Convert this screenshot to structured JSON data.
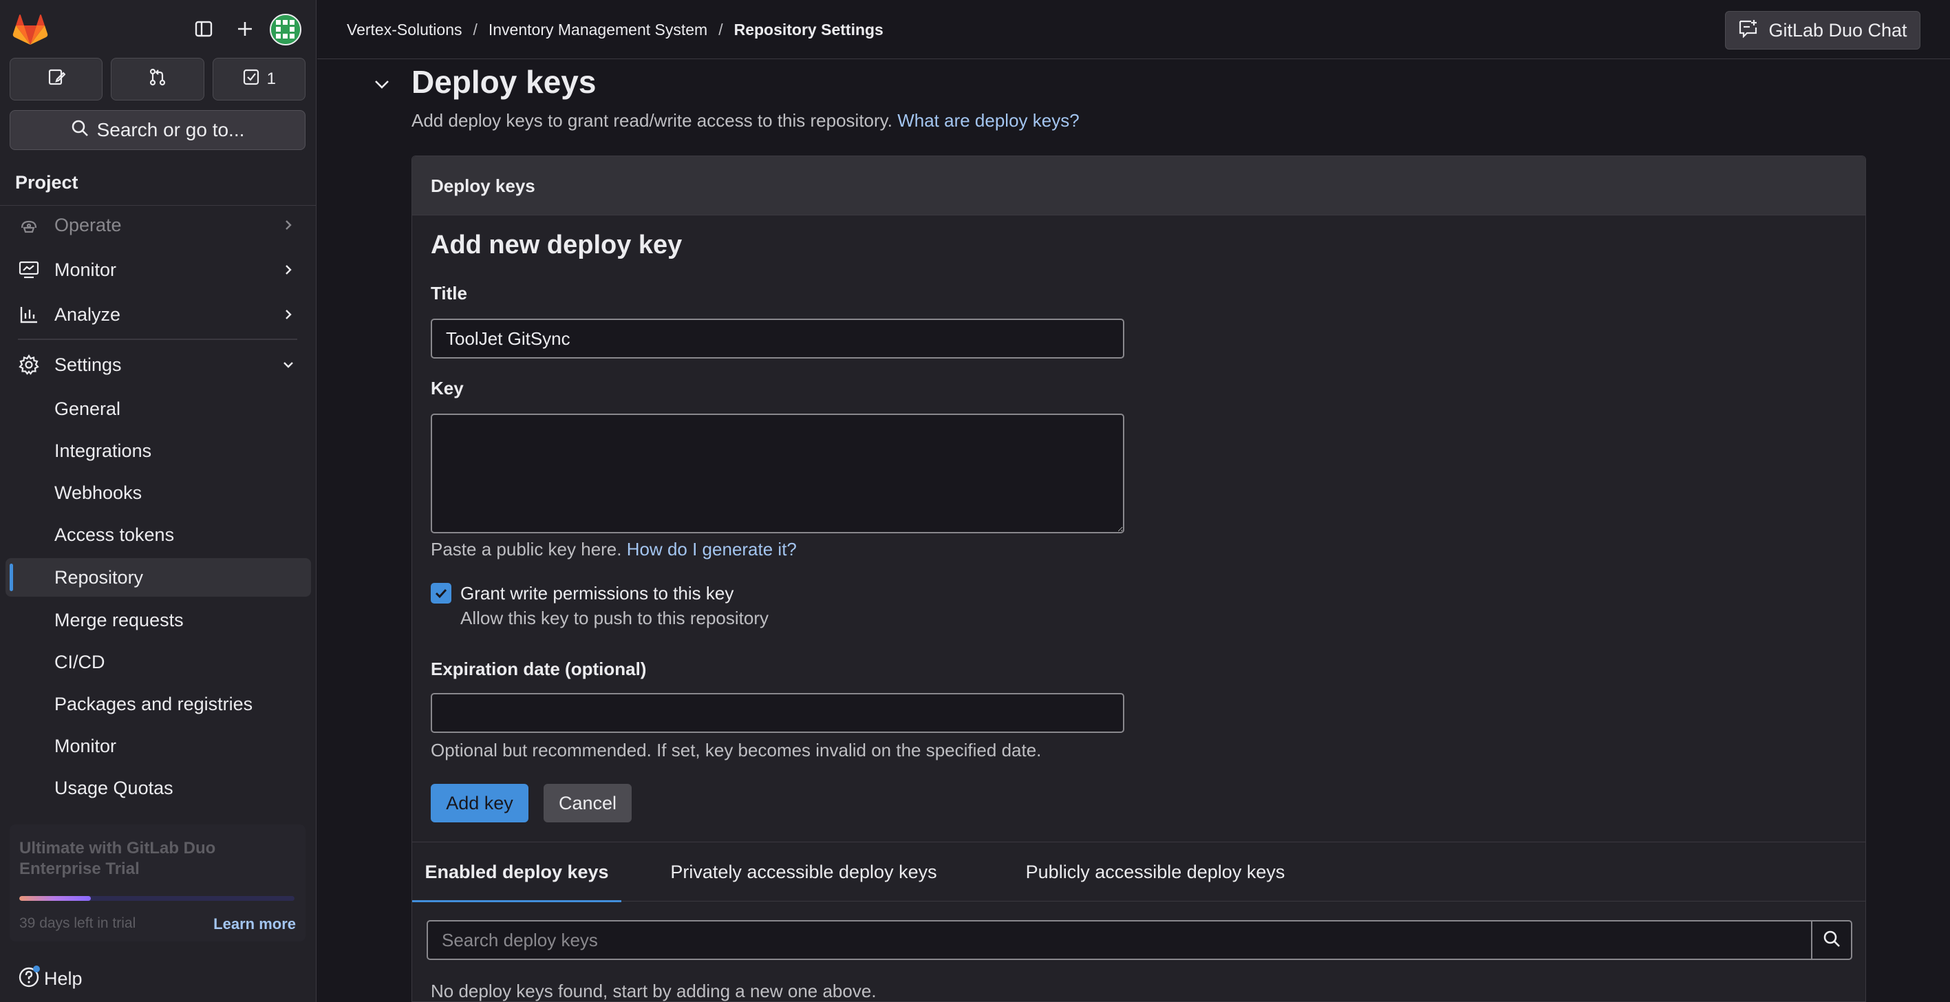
{
  "sidebar": {
    "todo_count": "1",
    "search_label": "Search or go to...",
    "section_title": "Project",
    "nav": [
      {
        "label": "Operate"
      },
      {
        "label": "Monitor"
      },
      {
        "label": "Analyze"
      },
      {
        "label": "Settings"
      }
    ],
    "settings_items": [
      {
        "label": "General"
      },
      {
        "label": "Integrations"
      },
      {
        "label": "Webhooks"
      },
      {
        "label": "Access tokens"
      },
      {
        "label": "Repository"
      },
      {
        "label": "Merge requests"
      },
      {
        "label": "CI/CD"
      },
      {
        "label": "Packages and registries"
      },
      {
        "label": "Monitor"
      },
      {
        "label": "Usage Quotas"
      }
    ],
    "trial": {
      "title": "Ultimate with GitLab Duo Enterprise Trial",
      "days_left": "39 days left in trial",
      "learn_more": "Learn more",
      "progress": 0.26
    },
    "help_label": "Help"
  },
  "topbar": {
    "breadcrumbs": [
      "Vertex-Solutions",
      "Inventory Management System",
      "Repository Settings"
    ],
    "separator": "/",
    "duo_chat_label": "GitLab Duo Chat"
  },
  "main": {
    "title": "Deploy keys",
    "description": "Add deploy keys to grant read/write access to this repository.",
    "description_link": "What are deploy keys?",
    "card_title": "Deploy keys",
    "form": {
      "heading": "Add new deploy key",
      "title_label": "Title",
      "title_value": "ToolJet GitSync",
      "key_label": "Key",
      "key_value": "",
      "key_help": "Paste a public key here.",
      "key_help_link": "How do I generate it?",
      "write_label": "Grant write permissions to this key",
      "write_help": "Allow this key to push to this repository",
      "write_checked": true,
      "expiration_label": "Expiration date (optional)",
      "expiration_value": "",
      "expiration_help": "Optional but recommended. If set, key becomes invalid on the specified date.",
      "add_button": "Add key",
      "cancel_button": "Cancel"
    },
    "tabs": [
      {
        "label": "Enabled deploy keys",
        "active": true
      },
      {
        "label": "Privately accessible deploy keys",
        "active": false
      },
      {
        "label": "Publicly accessible deploy keys",
        "active": false
      }
    ],
    "search_placeholder": "Search deploy keys",
    "empty_message": "No deploy keys found, start by adding a new one above."
  },
  "colors": {
    "background": "#18171d",
    "sidebar": "#232228",
    "accent": "#428fdc",
    "link": "#a3c5f0",
    "brand_orange": "#fc6d26"
  }
}
